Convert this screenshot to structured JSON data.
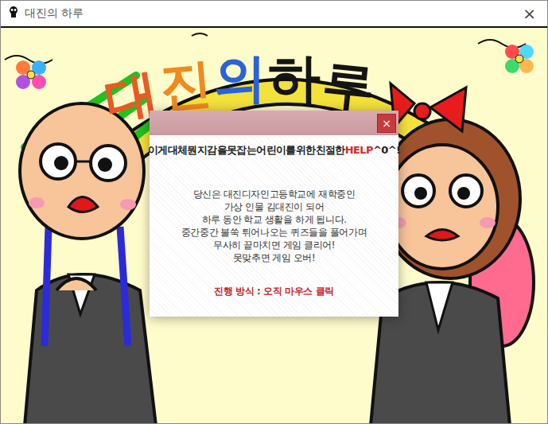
{
  "window": {
    "title": "대진의 하루",
    "close": "×"
  },
  "game": {
    "banner": [
      {
        "text": "대",
        "color": "#ea5a24"
      },
      {
        "text": "진",
        "color": "#f08a1c"
      },
      {
        "text": "의",
        "color": "#2b62d9"
      },
      {
        "text": "하",
        "color": "#141414"
      },
      {
        "text": "루",
        "color": "#141414"
      }
    ],
    "dialog": {
      "close": "×",
      "heading": [
        {
          "text": "이게대체뭔지감을못잡는어린이를위한친절한",
          "color": "#222222"
        },
        {
          "text": "HELP",
          "color": "#d42a2a"
        },
        {
          "text": "^0^!",
          "color": "#222222"
        }
      ],
      "lines": [
        "당신은 대진디자인고등학교에 재학중인",
        "가상 인물 김대진이 되어",
        "하루 동안 학교 생활을 하게 됩니다.",
        "중간중간 불쑥 튀어나오는 퀴즈들을 풀어가며",
        "무사히 끝마치면 게임 클리어!",
        "못맞추면 게임 오버!"
      ],
      "instruction": "진행 방식 : 오직 마우스 클릭"
    }
  }
}
